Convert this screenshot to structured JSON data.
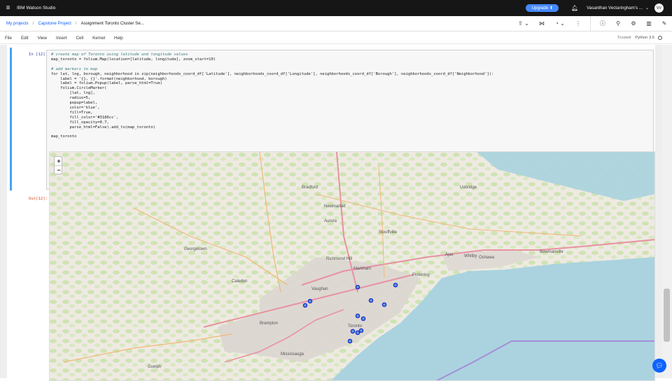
{
  "app": {
    "brand": "IBM Watson Studio",
    "upgrade_label": "Upgrade",
    "user": "Vasanthan Vectaringham's ...",
    "avatar_initials": "VV"
  },
  "breadcrumb": {
    "items": [
      "My projects",
      "Capstone Project",
      "Assignment Toronto Cluster Se..."
    ]
  },
  "menu": {
    "items": [
      "File",
      "Edit",
      "View",
      "Insert",
      "Cell",
      "Kernel",
      "Help"
    ],
    "trusted": "Trusted",
    "kernel": "Python 3.6"
  },
  "cell": {
    "in_prompt": "In [12]:",
    "out_prompt": "Out[12]:",
    "code_lines": [
      {
        "t": "c",
        "v": "# create map of Toronto using latitude and longitude values"
      },
      {
        "t": "n",
        "v": "map_toronto = folium.Map(location=[latitude, longitude], zoom_start=10)"
      },
      {
        "t": "n",
        "v": ""
      },
      {
        "t": "c",
        "v": "# add markers to map"
      },
      {
        "t": "n",
        "v": "for lat, lng, borough, neighborhood in zip(neighborhoods_coord_df['Latitude'], neighborhoods_coord_df['Longitude'], neighborhoods_coord_df['Borough'], neighborhoods_coord_df['Neighborhood']):"
      },
      {
        "t": "n",
        "v": "    label = '{}, {}'.format(neighborhood, borough)"
      },
      {
        "t": "n",
        "v": "    label = folium.Popup(label, parse_html=True)"
      },
      {
        "t": "n",
        "v": "    folium.CircleMarker("
      },
      {
        "t": "n",
        "v": "        [lat, lng],"
      },
      {
        "t": "n",
        "v": "        radius=5,"
      },
      {
        "t": "n",
        "v": "        popup=label,"
      },
      {
        "t": "n",
        "v": "        color='blue',"
      },
      {
        "t": "n",
        "v": "        fill=True,"
      },
      {
        "t": "n",
        "v": "        fill_color='#3186cc',"
      },
      {
        "t": "n",
        "v": "        fill_opacity=0.7,"
      },
      {
        "t": "n",
        "v": "        parse_html=False).add_to(map_toronto)"
      },
      {
        "t": "n",
        "v": ""
      },
      {
        "t": "n",
        "v": "map_toronto"
      }
    ]
  },
  "map": {
    "zoom_in": "+",
    "zoom_out": "−",
    "labels": [
      "Bradford",
      "Newmarket",
      "Aurora",
      "Stouffville",
      "Richmond Hill",
      "Markham",
      "Vaughan",
      "Pickering",
      "Ajax",
      "Whitby",
      "Oshawa",
      "Brampton",
      "Mississauga",
      "Caledon",
      "Georgetown",
      "Guelph",
      "Toronto",
      "Uxbridge",
      "Bowmanville"
    ],
    "marker_color": "#1f2fd6",
    "water_color": "#aad3df"
  }
}
